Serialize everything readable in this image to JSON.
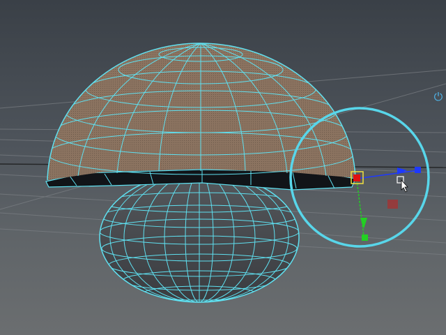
{
  "viewport": {
    "colors": {
      "background_top": "#3a4047",
      "background_bottom": "#6b6e70",
      "wireframe": "#5fe0f0",
      "cap_fill": "#8b7360",
      "stem_fill": "#4a4d51",
      "gizmo_ring": "#58d6ea",
      "axis_x": "#1d39ff",
      "axis_y": "#22d022",
      "axis_z": "#e01010"
    },
    "icons": [
      "view-axis-icon",
      "move-gizmo-icon",
      "cursor-arrow-icon"
    ],
    "axis_indicator_glyph": "⏻"
  }
}
